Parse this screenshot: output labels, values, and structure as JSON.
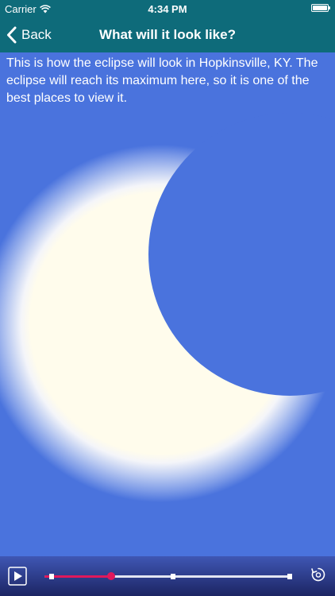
{
  "status_bar": {
    "carrier": "Carrier",
    "time": "4:34 PM"
  },
  "nav": {
    "back_label": "Back",
    "title": "What will it look like?"
  },
  "description": "This is how the eclipse will look in Hopkinsville, KY. The eclipse will reach its maximum here, so it is one of the best places to view it.",
  "colors": {
    "bar_teal": "#0e6b7a",
    "sky_blue": "#4a73dd",
    "sun_cream": "#fffcec",
    "timeline_progress": "#e0185c"
  },
  "timeline": {
    "progress_fraction": 0.27,
    "marker_fractions": [
      0.03,
      0.52,
      0.99
    ]
  },
  "icons": {
    "play": "play-icon",
    "replay": "replay-icon",
    "back": "chevron-left-icon",
    "wifi": "wifi-icon",
    "battery": "battery-icon"
  }
}
